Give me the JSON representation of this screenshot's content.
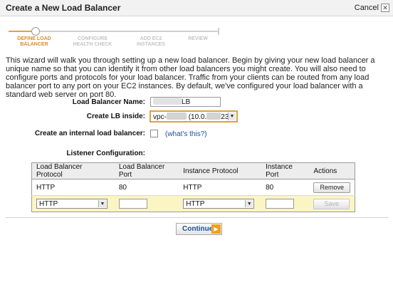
{
  "window": {
    "title": "Create a New Load Balancer",
    "cancel_label": "Cancel",
    "close_glyph": "✕"
  },
  "wizard": {
    "steps": [
      {
        "line1": "DEFINE LOAD",
        "line2": "BALANCER",
        "active": true
      },
      {
        "line1": "CONFIGURE",
        "line2": "HEALTH CHECK",
        "active": false
      },
      {
        "line1": "ADD EC2",
        "line2": "INSTANCES",
        "active": false
      },
      {
        "line1": "REVIEW",
        "line2": "",
        "active": false
      }
    ]
  },
  "intro_text": "This wizard will walk you through setting up a new load balancer. Begin by giving your new load balancer a unique name so that you can identify it from other load balancers you might create. You will also need to configure ports and protocols for your load balancer. Traffic from your clients can be routed from any load balancer port to any port on your EC2 instances. By default, we've configured your load balancer with a standard web server on port 80.",
  "form": {
    "name_label": "Load Balancer Name:",
    "name_value_suffix": "LB",
    "create_in_label": "Create LB inside:",
    "vpc_prefix": "vpc-",
    "vpc_middle": "(10.0.",
    "vpc_end": "23)",
    "internal_label": "Create an internal load balancer:",
    "internal_checked": false,
    "whats_this": "(what's this?)",
    "listener_label": "Listener Configuration:"
  },
  "listener_table": {
    "headers": [
      "Load Balancer Protocol",
      "Load Balancer Port",
      "Instance Protocol",
      "Instance Port",
      "Actions"
    ],
    "rows": [
      {
        "lb_protocol": "HTTP",
        "lb_port": "80",
        "instance_protocol": "HTTP",
        "instance_port": "80",
        "action": "Remove"
      }
    ],
    "new_row": {
      "lb_protocol": "HTTP",
      "lb_port": "",
      "instance_protocol": "HTTP",
      "instance_port": "",
      "action": "Save"
    }
  },
  "footer": {
    "continue_label": "Continue",
    "continue_icon": "▶"
  },
  "colors": {
    "accent_orange": "#e08a2a",
    "link_blue": "#1a4f9c",
    "edit_row": "#fbf5c4"
  }
}
